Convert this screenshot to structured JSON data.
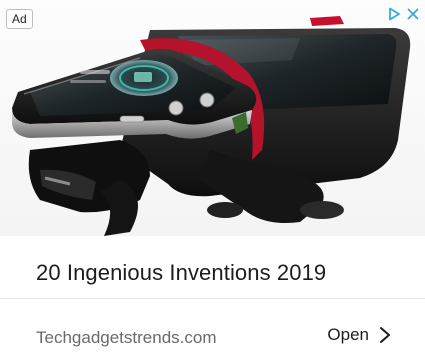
{
  "ad": {
    "badge_label": "Ad",
    "image_icon": "smartphone-bike-mount-photo",
    "adchoices_icon": "adchoices-triangle-icon",
    "close_icon": "close-icon",
    "accent_color": "#3aa7e0",
    "headline": "20 Ingenious Inventions 2019",
    "source": "Techgadgetstrends.com",
    "cta_label": "Open",
    "cta_icon": "chevron-right-icon"
  }
}
